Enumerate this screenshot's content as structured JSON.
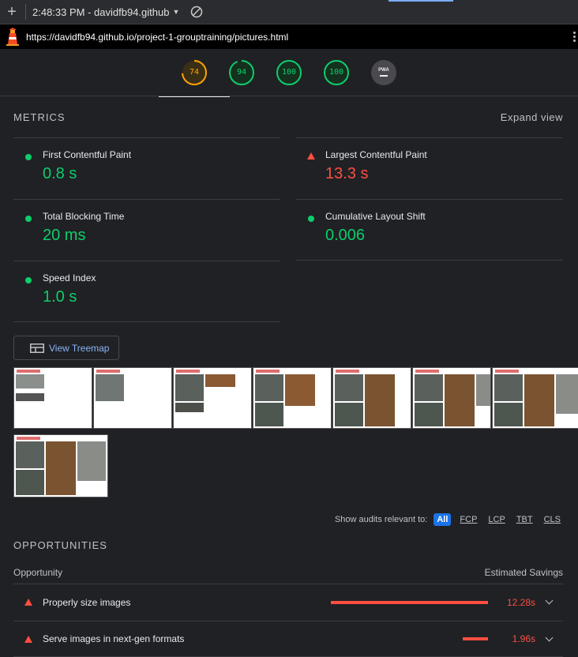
{
  "toolbar": {
    "add_label": "+",
    "report_select": "2:48:33 PM - davidfb94.github",
    "clear_icon": "block-icon"
  },
  "url": "https://davidfb94.github.io/project-1-grouptraining/pictures.html",
  "gauges": [
    {
      "name": "performance",
      "score": "74",
      "color": "#ffa400",
      "fraction": 0.74
    },
    {
      "name": "accessibility",
      "score": "94",
      "color": "#0cce6b",
      "fraction": 0.94
    },
    {
      "name": "best-practices",
      "score": "100",
      "color": "#0cce6b",
      "fraction": 1.0
    },
    {
      "name": "seo",
      "score": "100",
      "color": "#0cce6b",
      "fraction": 1.0
    }
  ],
  "pwa_label": "PWA",
  "metrics": {
    "title": "METRICS",
    "expand": "Expand view",
    "items": [
      {
        "label": "First Contentful Paint",
        "value": "0.8 s",
        "status": "pass"
      },
      {
        "label": "Largest Contentful Paint",
        "value": "13.3 s",
        "status": "fail"
      },
      {
        "label": "Total Blocking Time",
        "value": "20 ms",
        "status": "pass"
      },
      {
        "label": "Cumulative Layout Shift",
        "value": "0.006",
        "status": "pass"
      },
      {
        "label": "Speed Index",
        "value": "1.0 s",
        "status": "pass"
      }
    ]
  },
  "treemap_label": "View Treemap",
  "filter": {
    "label": "Show audits relevant to:",
    "chips": [
      "All",
      "FCP",
      "LCP",
      "TBT",
      "CLS"
    ]
  },
  "opportunities": {
    "title": "OPPORTUNITIES",
    "col_left": "Opportunity",
    "col_right": "Estimated Savings",
    "items": [
      {
        "label": "Properly size images",
        "savings": "12.28s",
        "bar_fraction": 1.0
      },
      {
        "label": "Serve images in next-gen formats",
        "savings": "1.96s",
        "bar_fraction": 0.16
      }
    ]
  },
  "colors": {
    "pass": "#0cce6b",
    "average": "#ffa400",
    "fail": "#ff4e42",
    "accent": "#1a73e8"
  }
}
